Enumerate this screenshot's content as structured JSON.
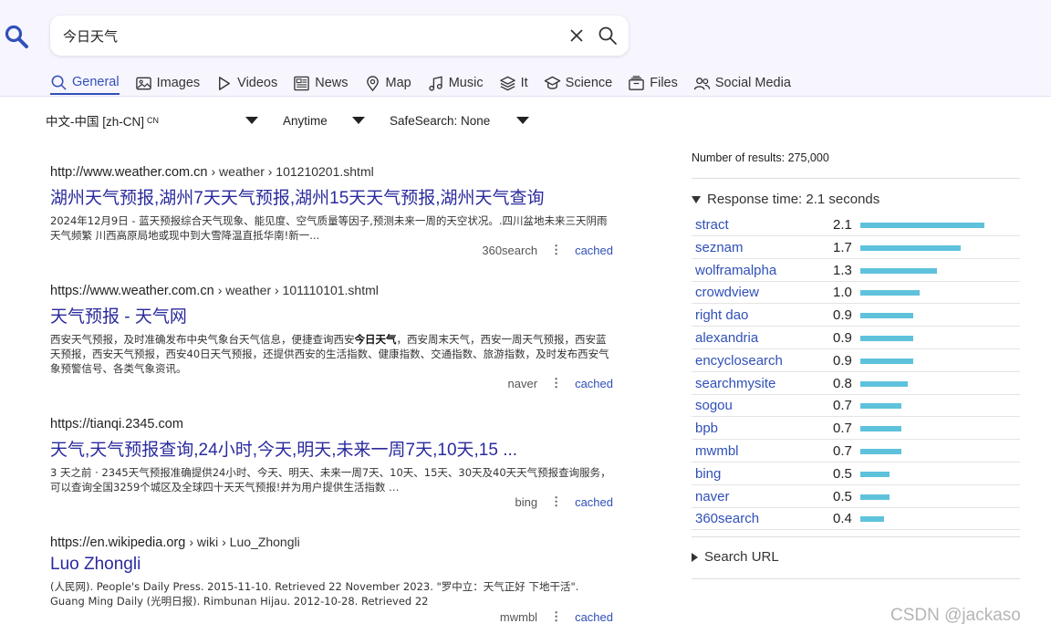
{
  "search": {
    "query": "今日天气"
  },
  "tabs": [
    {
      "label": "General",
      "icon": "search-icon",
      "active": true
    },
    {
      "label": "Images",
      "icon": "image-icon"
    },
    {
      "label": "Videos",
      "icon": "play-icon"
    },
    {
      "label": "News",
      "icon": "newspaper-icon"
    },
    {
      "label": "Map",
      "icon": "map-pin-icon"
    },
    {
      "label": "Music",
      "icon": "music-icon"
    },
    {
      "label": "It",
      "icon": "layers-icon"
    },
    {
      "label": "Science",
      "icon": "science-icon"
    },
    {
      "label": "Files",
      "icon": "files-icon"
    },
    {
      "label": "Social Media",
      "icon": "users-icon"
    }
  ],
  "filters": {
    "language": "中文-中国 [zh-CN]",
    "language_code": "CN",
    "time": "Anytime",
    "safesearch": "SafeSearch: None"
  },
  "results": [
    {
      "url": "http://www.weather.com.cn",
      "path": "› weather › 101210201.shtml",
      "title": "湖州天气预报,湖州7天天气预报,湖州15天天气预报,湖州天气查询",
      "snippet_pre": "2024年12月9日 - 蓝天预报综合天气现象、能见度、空气质量等因子,预测未来一周的天空状况。.四川盆地未来三天阴雨天气频繁 川西高原局地或现中到大雪降温直抵华南!新一...",
      "snippet_bold": "",
      "snippet_post": "",
      "engine": "360search",
      "cached": "cached"
    },
    {
      "url": "https://www.weather.com.cn",
      "path": "› weather › 101110101.shtml",
      "title": "天气预报 - 天气网",
      "snippet_pre": "西安天气预报，及时准确发布中央气象台天气信息，便捷查询西安",
      "snippet_bold": "今日天气",
      "snippet_post": "，西安周末天气，西安一周天气预报，西安蓝天预报，西安天气预报，西安40日天气预报，还提供西安的生活指数、健康指数、交通指数、旅游指数，及时发布西安气象预警信号、各类气象资讯。",
      "engine": "naver",
      "cached": "cached"
    },
    {
      "url": "https://tianqi.2345.com",
      "path": "",
      "title": "天气,天气预报查询,24小时,今天,明天,未来一周7天,10天,15 ...",
      "snippet_pre": "3 天之前 · 2345天气预报准确提供24小时、今天、明天、未来一周7天、10天、15天、30天及40天天气预报查询服务，可以查询全国3259个城区及全球四十天天气预报!并为用户提供生活指数 …",
      "snippet_bold": "",
      "snippet_post": "",
      "engine": "bing",
      "cached": "cached"
    },
    {
      "url": "https://en.wikipedia.org",
      "path": "› wiki › Luo_Zhongli",
      "title": "Luo Zhongli",
      "snippet_pre": "(人民网). People's Daily Press. 2015-11-10. Retrieved 22 November 2023. \"罗中立：天气正好 下地干活\". Guang Ming Daily (光明日报). Rimbunan Hijau. 2012-10-28. Retrieved 22",
      "snippet_bold": "",
      "snippet_post": "",
      "engine": "mwmbl",
      "cached": "cached"
    }
  ],
  "sidebar": {
    "number_of_results": "Number of results: 275,000",
    "response_time_label": "Response time: 2.1 seconds",
    "search_url_label": "Search URL",
    "engines": [
      {
        "name": "stract",
        "time": "2.1",
        "value": 2.1
      },
      {
        "name": "seznam",
        "time": "1.7",
        "value": 1.7
      },
      {
        "name": "wolframalpha",
        "time": "1.3",
        "value": 1.3
      },
      {
        "name": "crowdview",
        "time": "1.0",
        "value": 1.0
      },
      {
        "name": "right dao",
        "time": "0.9",
        "value": 0.9
      },
      {
        "name": "alexandria",
        "time": "0.9",
        "value": 0.9
      },
      {
        "name": "encyclosearch",
        "time": "0.9",
        "value": 0.9
      },
      {
        "name": "searchmysite",
        "time": "0.8",
        "value": 0.8
      },
      {
        "name": "sogou",
        "time": "0.7",
        "value": 0.7
      },
      {
        "name": "bpb",
        "time": "0.7",
        "value": 0.7
      },
      {
        "name": "mwmbl",
        "time": "0.7",
        "value": 0.7
      },
      {
        "name": "bing",
        "time": "0.5",
        "value": 0.5
      },
      {
        "name": "naver",
        "time": "0.5",
        "value": 0.5
      },
      {
        "name": "360search",
        "time": "0.4",
        "value": 0.4
      }
    ],
    "max_time": 2.1
  },
  "watermark": "CSDN @jackaso",
  "colors": {
    "accent": "#3050b8",
    "bar": "#5fc2dc",
    "header_bg": "#f7f5fe"
  }
}
